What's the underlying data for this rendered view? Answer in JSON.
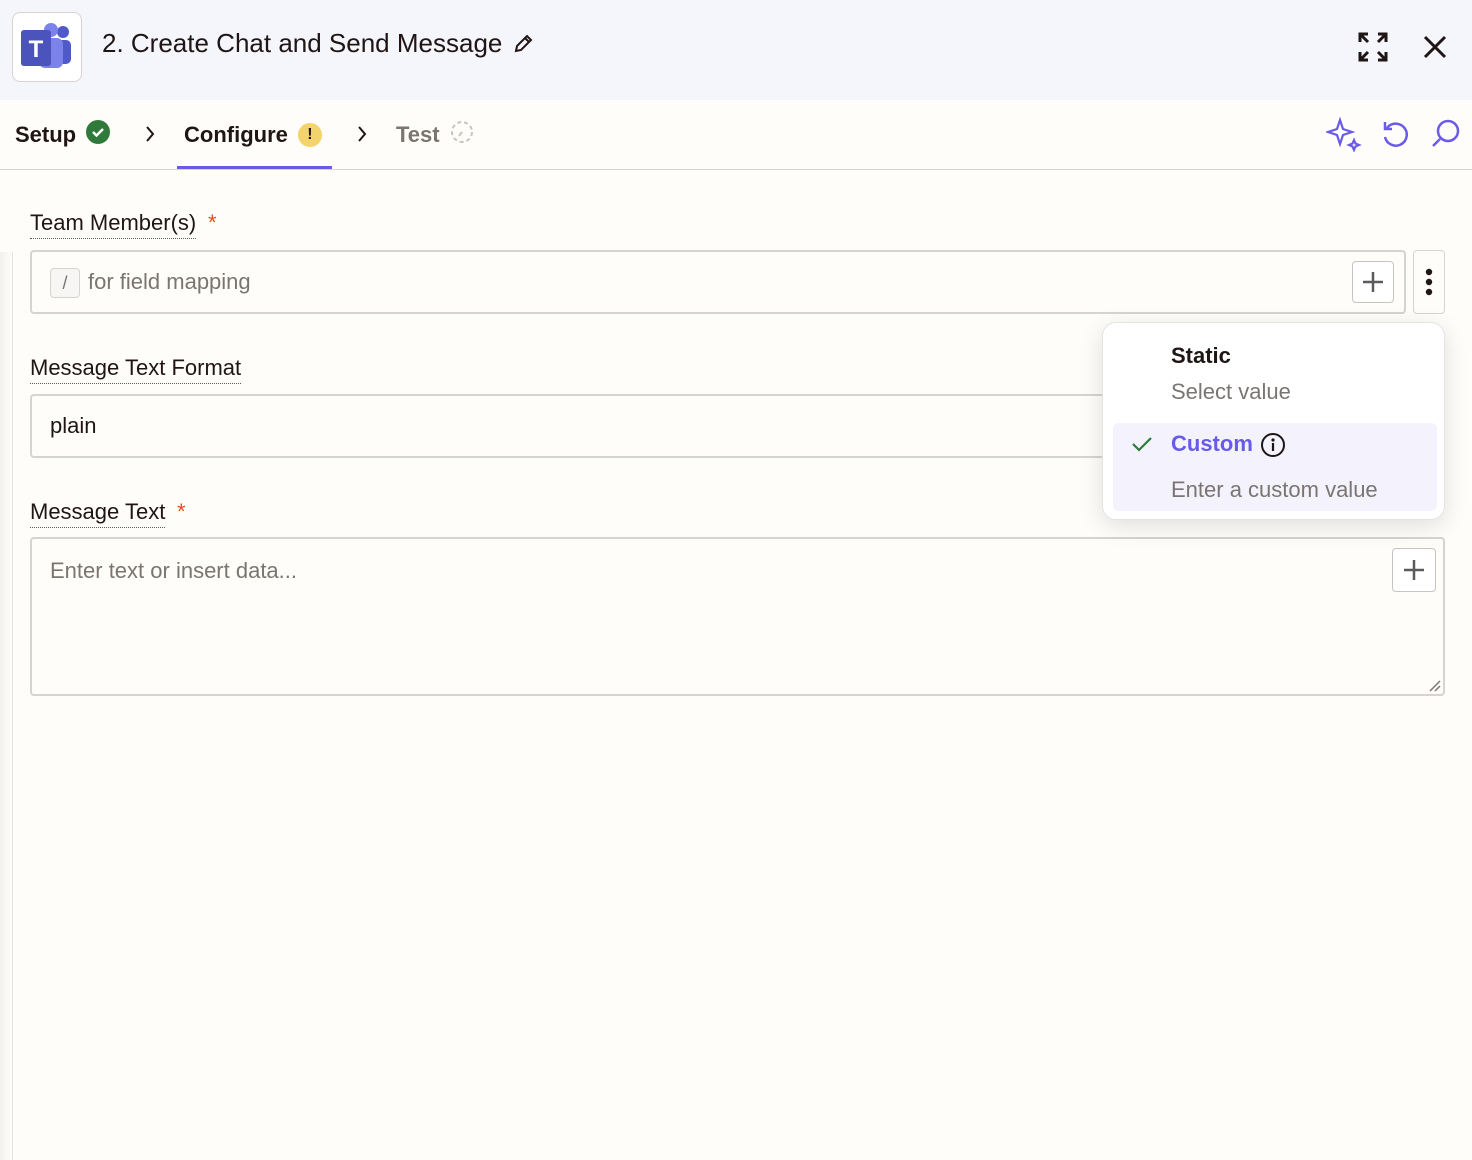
{
  "header": {
    "title": "2. Create Chat and Send Message",
    "app_icon": "microsoft-teams-logo",
    "actions": [
      "expand-icon",
      "close-icon"
    ]
  },
  "tabs": [
    {
      "label": "Setup",
      "status": "complete"
    },
    {
      "label": "Configure",
      "status": "warning",
      "badge": "!"
    },
    {
      "label": "Test",
      "status": "pending"
    }
  ],
  "toolbar": {
    "icons": [
      "sparkle-icon",
      "undo-icon",
      "search-icon"
    ]
  },
  "fields": {
    "team_members": {
      "label": "Team Member(s)",
      "required_mark": "*",
      "slash_hint": "/",
      "placeholder": "for field mapping"
    },
    "message_format": {
      "label": "Message Text Format",
      "value": "plain"
    },
    "message_text": {
      "label": "Message Text",
      "required_mark": "*",
      "placeholder": "Enter text or insert data..."
    }
  },
  "dropdown": {
    "options": [
      {
        "title": "Static",
        "subtitle": "Select value",
        "selected": false
      },
      {
        "title": "Custom",
        "subtitle": "Enter a custom value",
        "selected": true
      }
    ]
  },
  "colors": {
    "accent": "#695be8",
    "success": "#2f7a3a",
    "warning": "#f3d36b",
    "required": "#e0501e"
  }
}
